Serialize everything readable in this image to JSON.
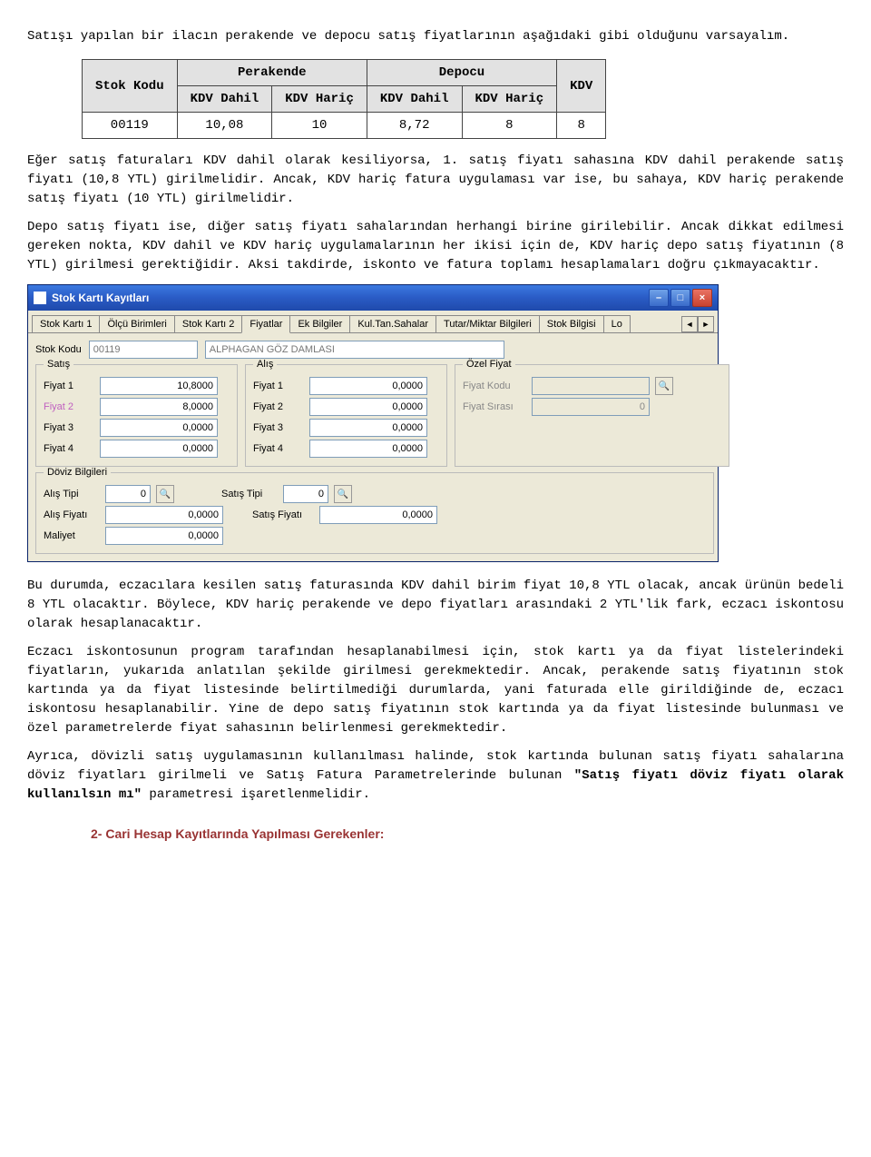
{
  "intro": "Satışı yapılan bir ilacın perakende ve depocu satış fiyatlarının aşağıdaki gibi olduğunu varsayalım.",
  "table": {
    "h_stock": "Stok Kodu",
    "h_perakende": "Perakende",
    "h_depocu": "Depocu",
    "h_kdv": "KDV",
    "h_kdv_dahil": "KDV Dahil",
    "h_kdv_haric": "KDV Hariç",
    "row": {
      "code": "00119",
      "pd": "10,08",
      "ph": "10",
      "dd": "8,72",
      "dh": "8",
      "kdv": "8"
    }
  },
  "p2": "Eğer satış faturaları KDV dahil olarak kesiliyorsa, 1. satış fiyatı sahasına KDV dahil perakende satış fiyatı (10,8 YTL) girilmelidir. Ancak, KDV hariç fatura uygulaması var ise, bu sahaya, KDV hariç perakende satış fiyatı (10 YTL) girilmelidir.",
  "p3": "Depo satış fiyatı ise, diğer satış fiyatı sahalarından herhangi birine girilebilir. Ancak dikkat edilmesi gereken nokta, KDV dahil ve KDV hariç uygulamalarının her ikisi için de, KDV hariç depo satış fiyatının (8 YTL) girilmesi gerektiğidir. Aksi takdirde, iskonto ve fatura toplamı hesaplamaları doğru çıkmayacaktır.",
  "win": {
    "title": "Stok Kartı Kayıtları",
    "tabs": [
      "Stok Kartı 1",
      "Ölçü Birimleri",
      "Stok Kartı 2",
      "Fiyatlar",
      "Ek Bilgiler",
      "Kul.Tan.Sahalar",
      "Tutar/Miktar Bilgileri",
      "Stok Bilgisi",
      "Lo"
    ],
    "stok_kodu_lbl": "Stok Kodu",
    "stok_kodu_val": "00119",
    "stok_name": "ALPHAGAN GÖZ DAMLASI",
    "satis": {
      "legend": "Satış",
      "f1l": "Fiyat 1",
      "f1v": "10,8000",
      "f2l": "Fiyat 2",
      "f2v": "8,0000",
      "f3l": "Fiyat 3",
      "f3v": "0,0000",
      "f4l": "Fiyat 4",
      "f4v": "0,0000"
    },
    "alis": {
      "legend": "Alış",
      "f1l": "Fiyat 1",
      "f1v": "0,0000",
      "f2l": "Fiyat 2",
      "f2v": "0,0000",
      "f3l": "Fiyat 3",
      "f3v": "0,0000",
      "f4l": "Fiyat 4",
      "f4v": "0,0000"
    },
    "ozel": {
      "legend": "Özel Fiyat",
      "kodu_lbl": "Fiyat Kodu",
      "sirasi_lbl": "Fiyat Sırası",
      "sirasi_val": "0"
    },
    "doviz": {
      "legend": "Döviz Bilgileri",
      "alis_tipi_lbl": "Alış Tipi",
      "alis_tipi_val": "0",
      "satis_tipi_lbl": "Satış Tipi",
      "satis_tipi_val": "0",
      "alis_fiyat_lbl": "Alış Fiyatı",
      "alis_fiyat_val": "0,0000",
      "satis_fiyat_lbl": "Satış Fiyatı",
      "satis_fiyat_val": "0,0000",
      "maliyet_lbl": "Maliyet",
      "maliyet_val": "0,0000"
    }
  },
  "p4": "Bu durumda, eczacılara kesilen satış faturasında KDV dahil birim fiyat 10,8 YTL olacak, ancak ürünün bedeli 8 YTL olacaktır. Böylece, KDV hariç perakende ve depo fiyatları arasındaki 2 YTL'lik fark, eczacı iskontosu olarak hesaplanacaktır.",
  "p5": "Eczacı iskontosunun program tarafından hesaplanabilmesi için, stok kartı ya da fiyat listelerindeki fiyatların, yukarıda anlatılan şekilde girilmesi gerekmektedir. Ancak, perakende satış fiyatının stok kartında ya da fiyat listesinde belirtilmediği durumlarda, yani faturada elle girildiğinde de, eczacı iskontosu hesaplanabilir. Yine de depo satış fiyatının stok kartında ya da fiyat listesinde bulunması ve özel parametrelerde fiyat sahasının belirlenmesi gerekmektedir.",
  "p6a": "Ayrıca, dövizli satış uygulamasının kullanılması halinde, stok kartında bulunan satış fiyatı sahalarına döviz fiyatları girilmeli ve Satış Fatura Parametrelerinde bulunan ",
  "p6b": "\"Satış fiyatı döviz fiyatı olarak kullanılsın mı\"",
  "p6c": " parametresi işaretlenmelidir.",
  "section2": "2- Cari Hesap Kayıtlarında Yapılması Gerekenler:"
}
